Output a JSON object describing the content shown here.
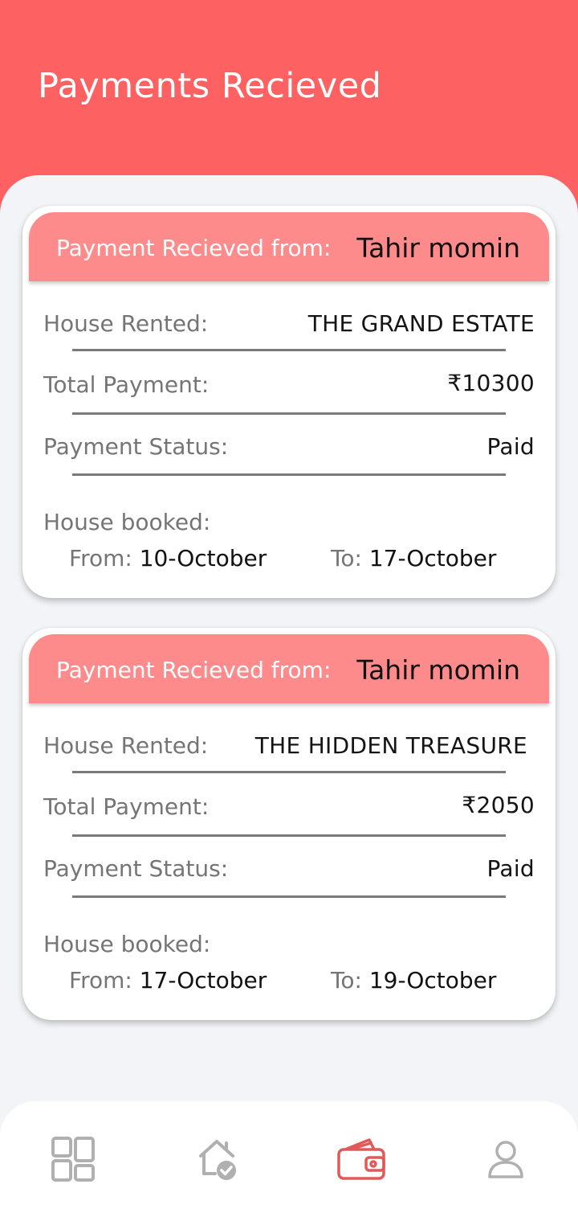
{
  "header": {
    "title": "Payments Recieved",
    "color": "#fe6161"
  },
  "payments": [
    {
      "from_label": "Payment Recieved from:",
      "from_name": "Tahir momin",
      "house_label": "House Rented:",
      "house_value": "THE GRAND ESTATE",
      "total_label": "Total Payment:",
      "total_value": "₹10300",
      "status_label": "Payment Status:",
      "status_value": "Paid",
      "booked_label": "House booked:",
      "from_date_label": "From:",
      "from_date": "10-October",
      "to_date_label": "To:",
      "to_date": "17-October"
    },
    {
      "from_label": "Payment Recieved from:",
      "from_name": "Tahir momin",
      "house_label": "House Rented:",
      "house_value": "THE HIDDEN TREASURE",
      "total_label": "Total Payment:",
      "total_value": "₹2050",
      "status_label": "Payment Status:",
      "status_value": "Paid",
      "booked_label": "House booked:",
      "from_date_label": "From:",
      "from_date": "17-October",
      "to_date_label": "To:",
      "to_date": "19-October"
    }
  ],
  "bottom_nav": {
    "items": [
      {
        "icon": "dashboard-grid-icon",
        "active": false
      },
      {
        "icon": "house-check-icon",
        "active": false
      },
      {
        "icon": "wallet-icon",
        "active": true
      },
      {
        "icon": "user-profile-icon",
        "active": false
      }
    ],
    "active_color": "#e05a5a",
    "inactive_color": "#b0b0b0"
  }
}
